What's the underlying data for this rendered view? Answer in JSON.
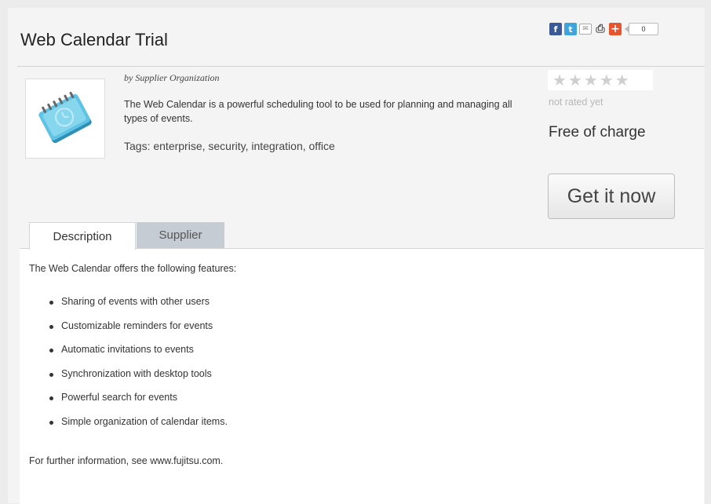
{
  "product": {
    "title": "Web Calendar Trial",
    "by_line": "by Supplier Organization",
    "description": "The Web Calendar is a powerful scheduling tool to be used for planning and managing all types of events.",
    "tags": "Tags: enterprise, security, integration, office"
  },
  "share": {
    "count": "0",
    "icons": [
      "facebook-icon",
      "twitter-icon",
      "email-icon",
      "print-icon",
      "addthis-plus-icon"
    ]
  },
  "rating": {
    "stars_filled": 0,
    "stars_total": 5,
    "status": "not rated yet"
  },
  "price": "Free of charge",
  "action": {
    "get_label": "Get it now"
  },
  "tabs": [
    {
      "label": "Description",
      "active": true
    },
    {
      "label": "Supplier",
      "active": false
    }
  ],
  "content": {
    "intro": "The Web Calendar offers the following features:",
    "features": [
      "Sharing of events with other users",
      "Customizable reminders for events",
      "Automatic invitations to events",
      "Synchronization with desktop tools",
      "Powerful search for events",
      "Simple organization of calendar items."
    ],
    "footer": "For further information, see www.fujitsu.com."
  },
  "colors": {
    "facebook": "#3b5998",
    "twitter": "#3fa4dc",
    "addthis": "#e8542e",
    "tab_inactive": "#c5ccd3",
    "star_empty": "#cfcfcf"
  }
}
